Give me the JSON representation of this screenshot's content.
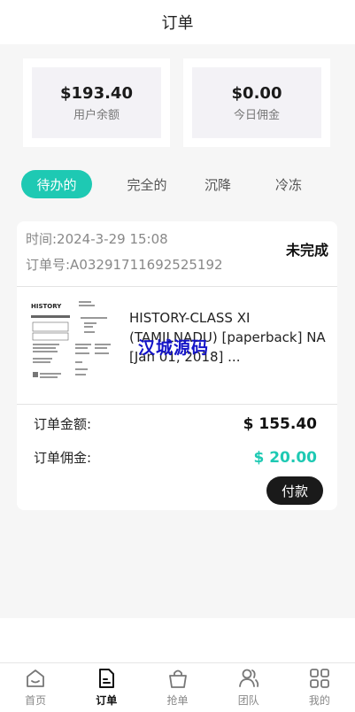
{
  "header": {
    "title": "订单"
  },
  "stats": [
    {
      "value": "$193.40",
      "label": "用户余额"
    },
    {
      "value": "$0.00",
      "label": "今日佣金"
    }
  ],
  "tabs": [
    {
      "label": "待办的",
      "active": true
    },
    {
      "label": "完全的",
      "active": false
    },
    {
      "label": "沉降",
      "active": false
    },
    {
      "label": "冷冻",
      "active": false
    }
  ],
  "order": {
    "time": "时间:2024-3-29 15:08",
    "number": "订单号:A03291711692525192",
    "status": "未完成",
    "product_title": "HISTORY-CLASS XI (TAMILNADU) [paperback] NA [Jan 01, 2018] ...",
    "thumbnail_heading": "HISTORY",
    "watermark": "汉城源码",
    "amount_label": "订单金额:",
    "amount_value": "$ 155.40",
    "commission_label": "订单佣金:",
    "commission_value": "$ 20.00",
    "pay_label": "付款"
  },
  "tabbar": [
    {
      "label": "首页",
      "icon": "home-icon",
      "active": false
    },
    {
      "label": "订单",
      "icon": "order-document-icon",
      "active": true
    },
    {
      "label": "抢单",
      "icon": "shopping-bag-icon",
      "active": false
    },
    {
      "label": "团队",
      "icon": "team-icon",
      "active": false
    },
    {
      "label": "我的",
      "icon": "grid-icon",
      "active": false
    }
  ],
  "colors": {
    "accent": "#1ec9b3",
    "dark": "#1a1a1a",
    "watermark": "#1414c8"
  }
}
